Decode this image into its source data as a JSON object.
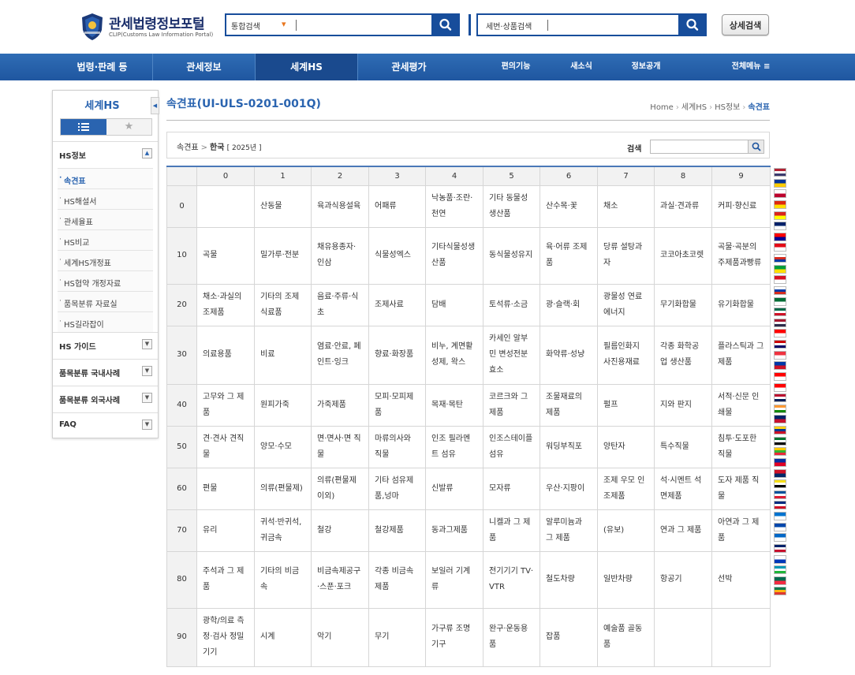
{
  "header": {
    "logo_title": "관세법령정보포털",
    "logo_sub": "CLIP(Customs Law Information Portal)",
    "search_main": {
      "select_label": "통합검색",
      "value": ""
    },
    "search_item": {
      "select_label": "세번·상품검색",
      "value": ""
    },
    "detail_search_label": "상세검색"
  },
  "nav": {
    "items": [
      {
        "label": "법령·판례 등"
      },
      {
        "label": "관세정보"
      },
      {
        "label": "세계HS"
      },
      {
        "label": "관세평가"
      },
      {
        "label": "편의기능"
      },
      {
        "label": "새소식"
      },
      {
        "label": "정보공개"
      },
      {
        "label": "전체메뉴 ≡"
      }
    ]
  },
  "sidebar": {
    "title": "세계HS",
    "sections": [
      {
        "label": "HS정보"
      },
      {
        "label": "HS 가이드"
      },
      {
        "label": "품목분류 국내사례"
      },
      {
        "label": "품목분류 외국사례"
      },
      {
        "label": "FAQ"
      }
    ],
    "hs_items": [
      {
        "label": "속견표"
      },
      {
        "label": "HS해설서"
      },
      {
        "label": "관세율표"
      },
      {
        "label": "HS비교"
      },
      {
        "label": "세계HS개정표"
      },
      {
        "label": "HS협약 개정자료"
      },
      {
        "label": "품목분류 자료실"
      },
      {
        "label": "HS길라잡이"
      }
    ]
  },
  "content": {
    "page_title": "속견표(UI-ULS-0201-001Q)",
    "breadcrumb": [
      "Home",
      "세계HS",
      "HS정보",
      "속견표"
    ],
    "filter_path_1": "속견표",
    "filter_path_2": "한국",
    "filter_path_3": "[ 2025년 ]",
    "search_label": "검색",
    "search_value": ""
  },
  "table": {
    "columns": [
      "0",
      "1",
      "2",
      "3",
      "4",
      "5",
      "6",
      "7",
      "8",
      "9"
    ],
    "rows": [
      {
        "label": "0",
        "cells": [
          "",
          "산동물",
          "육과식용설육",
          "어패류",
          "낙농품·조란·천연",
          "기타 동물성 생산품",
          "산수목·꽃",
          "채소",
          "과실·견과류",
          "커피·향신료"
        ]
      },
      {
        "label": "10",
        "cells": [
          "곡물",
          "밀가루·전분",
          "채유용종자·인삼",
          "식물성엑스",
          "기타식물성생산품",
          "동식물성유지",
          "육·어류 조제품",
          "당류 설탕과자",
          "코코아초코렛",
          "곡물·곡분의 주제품과빵류"
        ]
      },
      {
        "label": "20",
        "cells": [
          "채소·과실의조제품",
          "기타의 조제식료품",
          "음료·주류·식초",
          "조제사료",
          "담배",
          "토석류·소금",
          "광·슬랙·회",
          "광물성 연료 에너지",
          "무기화합물",
          "유기화합물"
        ]
      },
      {
        "label": "30",
        "cells": [
          "의료용품",
          "비료",
          "염료·안료, 페인트·잉크",
          "향료·화장품",
          "비누, 계면활성제, 왁스",
          "카세인 알부민 변성전분 효소",
          "화약류·성냥",
          "필름인화지 사진용재료",
          "각종 화학공업 생산품",
          "플라스틱과 그제품"
        ]
      },
      {
        "label": "40",
        "cells": [
          "고무와 그 제품",
          "원피가죽",
          "가죽제품",
          "모피·모피제품",
          "목재·목탄",
          "코르크와 그 제품",
          "조물재료의 제품",
          "펄프",
          "지와 판지",
          "서적·신문 인쇄물"
        ]
      },
      {
        "label": "50",
        "cells": [
          "견·견사 견직물",
          "양모·수모",
          "면·면사·면 직물",
          "마류의사와 직물",
          "인조 필라멘트 섬유",
          "인조스테이플 섬유",
          "워딩부직포",
          "양탄자",
          "특수직물",
          "침투·도포한 직물"
        ]
      },
      {
        "label": "60",
        "cells": [
          "편물",
          "의류(편물제)",
          "의류(편물제이외)",
          "기타 섬유제품,넝마",
          "신발류",
          "모자류",
          "우산·지팡이",
          "조제 우모 인조제품",
          "석·시멘트 석면제품",
          "도자 제품 직물"
        ]
      },
      {
        "label": "70",
        "cells": [
          "유리",
          "귀석·반귀석,귀금속",
          "철강",
          "철강제품",
          "동과그제품",
          "니켈과 그 제품",
          "알루미늄과 그 제품",
          "(유보)",
          "연과 그 제품",
          "아연과 그 제품"
        ]
      },
      {
        "label": "80",
        "cells": [
          "주석과 그 제품",
          "기타의 비금속",
          "비금속제공구·스푼·포크",
          "각종 비금속 제품",
          "보일러 기계류",
          "전기기기 TV·VTR",
          "철도차량",
          "일반차량",
          "항공기",
          "선박"
        ]
      },
      {
        "label": "90",
        "cells": [
          "광학/의료 측정·검사 정밀기기",
          "시계",
          "악기",
          "무기",
          "가구류 조명기구",
          "완구·운동용품",
          "잡품",
          "예술품 골동품",
          "",
          ""
        ]
      }
    ]
  },
  "flags": [
    {
      "name": "us",
      "colors": [
        "#b22234",
        "#ffffff",
        "#3c3b6e"
      ]
    },
    {
      "name": "eu",
      "colors": [
        "#003399",
        "#ffcc00"
      ]
    },
    {
      "name": "jp",
      "colors": [
        "#ffffff",
        "#bc002d"
      ]
    },
    {
      "name": "cn",
      "colors": [
        "#de2910",
        "#ffde00"
      ]
    },
    {
      "name": "vn",
      "colors": [
        "#da251d",
        "#ffff00"
      ]
    },
    {
      "name": "au",
      "colors": [
        "#012169",
        "#ffffff"
      ]
    },
    {
      "name": "tw",
      "colors": [
        "#fe0000",
        "#000095"
      ]
    },
    {
      "name": "tr",
      "colors": [
        "#e30a17",
        "#ffffff"
      ]
    },
    {
      "name": "cl",
      "colors": [
        "#ffffff",
        "#d52b1e",
        "#0039a6"
      ]
    },
    {
      "name": "br",
      "colors": [
        "#009c3b",
        "#ffdf00"
      ]
    },
    {
      "name": "pe",
      "colors": [
        "#d91023",
        "#ffffff"
      ]
    },
    {
      "name": "ru",
      "colors": [
        "#ffffff",
        "#0039a6",
        "#d52b1e"
      ]
    },
    {
      "name": "sa",
      "colors": [
        "#006c35",
        "#ffffff"
      ]
    },
    {
      "name": "mx",
      "colors": [
        "#006847",
        "#ffffff",
        "#ce1126"
      ]
    },
    {
      "name": "th",
      "colors": [
        "#a51931",
        "#f4f5f8",
        "#2d2a4a"
      ]
    },
    {
      "name": "id",
      "colors": [
        "#ff0000",
        "#ffffff"
      ]
    },
    {
      "name": "my",
      "colors": [
        "#cc0001",
        "#ffffff",
        "#010066"
      ]
    },
    {
      "name": "sg",
      "colors": [
        "#ef3340",
        "#ffffff"
      ]
    },
    {
      "name": "ph",
      "colors": [
        "#0038a8",
        "#ce1126"
      ]
    },
    {
      "name": "ca",
      "colors": [
        "#ff0000",
        "#ffffff"
      ]
    },
    {
      "name": "ch",
      "colors": [
        "#ff0000",
        "#ffffff"
      ]
    },
    {
      "name": "no",
      "colors": [
        "#ba0c2f",
        "#ffffff",
        "#00205b"
      ]
    },
    {
      "name": "in",
      "colors": [
        "#ff9933",
        "#ffffff",
        "#138808"
      ]
    },
    {
      "name": "nz",
      "colors": [
        "#012169",
        "#c8102e"
      ]
    },
    {
      "name": "co",
      "colors": [
        "#fcd116",
        "#003893",
        "#ce1126"
      ]
    },
    {
      "name": "ae",
      "colors": [
        "#00732f",
        "#ffffff",
        "#000000"
      ]
    },
    {
      "name": "mm",
      "colors": [
        "#fecb00",
        "#34b233",
        "#ea2839"
      ]
    },
    {
      "name": "kh",
      "colors": [
        "#032ea1",
        "#e00025"
      ]
    },
    {
      "name": "la",
      "colors": [
        "#ce1126",
        "#002868"
      ]
    },
    {
      "name": "bn",
      "colors": [
        "#f7e017",
        "#ffffff",
        "#000000"
      ]
    },
    {
      "name": "is",
      "colors": [
        "#02529c",
        "#ffffff",
        "#dc1e35"
      ]
    },
    {
      "name": "cr",
      "colors": [
        "#002b7f",
        "#ffffff",
        "#ce1126"
      ]
    },
    {
      "name": "hn",
      "colors": [
        "#0073cf",
        "#ffffff"
      ]
    },
    {
      "name": "sv",
      "colors": [
        "#0047ab",
        "#ffffff"
      ]
    },
    {
      "name": "ni",
      "colors": [
        "#0067c6",
        "#ffffff"
      ]
    },
    {
      "name": "gb",
      "colors": [
        "#012169",
        "#ffffff",
        "#c8102e"
      ]
    },
    {
      "name": "il",
      "colors": [
        "#ffffff",
        "#0038b8"
      ]
    },
    {
      "name": "uz",
      "colors": [
        "#0099b5",
        "#ffffff",
        "#1eb53a"
      ]
    },
    {
      "name": "bd",
      "colors": [
        "#006a4e",
        "#f42a41"
      ]
    },
    {
      "name": "za",
      "colors": [
        "#007a4d",
        "#ffb612",
        "#de3831"
      ]
    }
  ]
}
